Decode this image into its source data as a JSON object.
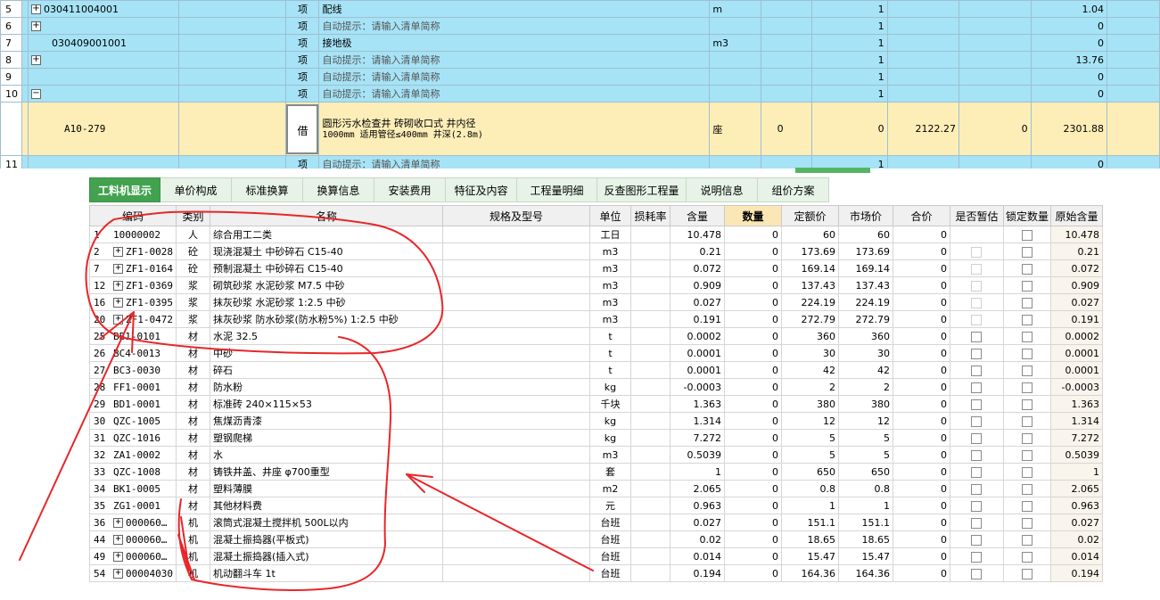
{
  "top_rows": [
    {
      "row": "5",
      "expand": "+",
      "code": "030411004001",
      "type": "项",
      "name": "配线",
      "hint": false,
      "unit": "m",
      "qty": "",
      "formula": "1",
      "price": "",
      "hj": "",
      "total": "1.04"
    },
    {
      "row": "6",
      "expand": "+",
      "code": "",
      "type": "项",
      "name": "自动提示：请输入清单简称",
      "hint": true,
      "unit": "",
      "qty": "",
      "formula": "1",
      "price": "",
      "hj": "",
      "total": "0"
    },
    {
      "row": "7",
      "expand": "",
      "code": "030409001001",
      "type": "项",
      "name": "接地极",
      "hint": false,
      "unit": "m3",
      "qty": "",
      "formula": "1",
      "price": "",
      "hj": "",
      "total": "0"
    },
    {
      "row": "8",
      "expand": "+",
      "code": "",
      "type": "项",
      "name": "自动提示：请输入清单简称",
      "hint": true,
      "unit": "",
      "qty": "",
      "formula": "1",
      "price": "",
      "hj": "",
      "total": "13.76"
    },
    {
      "row": "9",
      "expand": "",
      "code": "",
      "type": "项",
      "name": "自动提示：请输入清单简称",
      "hint": true,
      "unit": "",
      "qty": "",
      "formula": "1",
      "price": "",
      "hj": "",
      "total": "0"
    },
    {
      "row": "10",
      "expand": "−",
      "code": "",
      "type": "项",
      "name": "自动提示：请输入清单简称",
      "hint": true,
      "unit": "",
      "qty": "",
      "formula": "1",
      "price": "",
      "hj": "",
      "total": "0"
    }
  ],
  "selected_row": {
    "code": "A10-279",
    "type": "借",
    "name_line1": "圆形污水检查井 砖砌收口式 井内径",
    "name_line2": "1000mm 适用管径≤400mm 井深(2.8m)",
    "unit": "座",
    "qty": "0",
    "formula": "0",
    "price": "2122.27",
    "hj": "0",
    "total": "2301.88"
  },
  "partial_row": {
    "row": "11",
    "type": "项",
    "name": "自动提示：请输入清单简称",
    "formula": "1",
    "total": "0"
  },
  "tabs": [
    "工料机显示",
    "单价构成",
    "标准换算",
    "换算信息",
    "安装费用",
    "特征及内容",
    "工程量明细",
    "反查图形工程量",
    "说明信息",
    "组价方案"
  ],
  "columns": [
    "编码",
    "类别",
    "名称",
    "规格及型号",
    "单位",
    "损耗率",
    "含量",
    "数量",
    "定额价",
    "市场价",
    "合价",
    "是否暂估",
    "锁定数量",
    "原始含量"
  ],
  "rows": [
    {
      "n": "1",
      "exp": false,
      "code": "10000002",
      "cat": "人",
      "name": "综合用工二类",
      "spec": "",
      "unit": "工日",
      "content": "10.478",
      "qty": "0",
      "quota": "60",
      "market": "60",
      "sum": "0",
      "est": false,
      "orig": "10.478"
    },
    {
      "n": "2",
      "exp": true,
      "code": "ZF1-0028",
      "cat": "砼",
      "name": "现浇混凝土 中砂碎石 C15-40",
      "spec": "",
      "unit": "m3",
      "content": "0.21",
      "qty": "0",
      "quota": "173.69",
      "market": "173.69",
      "sum": "0",
      "est": true,
      "orig": "0.21"
    },
    {
      "n": "7",
      "exp": true,
      "code": "ZF1-0164",
      "cat": "砼",
      "name": "预制混凝土 中砂碎石 C15-40",
      "spec": "",
      "unit": "m3",
      "content": "0.072",
      "qty": "0",
      "quota": "169.14",
      "market": "169.14",
      "sum": "0",
      "est": true,
      "orig": "0.072"
    },
    {
      "n": "12",
      "exp": true,
      "code": "ZF1-0369",
      "cat": "浆",
      "name": "砌筑砂浆 水泥砂浆 M7.5 中砂",
      "spec": "",
      "unit": "m3",
      "content": "0.909",
      "qty": "0",
      "quota": "137.43",
      "market": "137.43",
      "sum": "0",
      "est": true,
      "orig": "0.909"
    },
    {
      "n": "16",
      "exp": true,
      "code": "ZF1-0395",
      "cat": "浆",
      "name": "抹灰砂浆 水泥砂浆 1:2.5 中砂",
      "spec": "",
      "unit": "m3",
      "content": "0.027",
      "qty": "0",
      "quota": "224.19",
      "market": "224.19",
      "sum": "0",
      "est": true,
      "orig": "0.027"
    },
    {
      "n": "20",
      "exp": true,
      "code": "ZF1-0472",
      "cat": "浆",
      "name": "抹灰砂浆 防水砂浆(防水粉5%) 1:2.5 中砂",
      "spec": "",
      "unit": "m3",
      "content": "0.191",
      "qty": "0",
      "quota": "272.79",
      "market": "272.79",
      "sum": "0",
      "est": true,
      "orig": "0.191"
    },
    {
      "n": "25",
      "exp": false,
      "code": "BB1-0101",
      "cat": "材",
      "name": "水泥 32.5",
      "spec": "",
      "unit": "t",
      "content": "0.0002",
      "qty": "0",
      "quota": "360",
      "market": "360",
      "sum": "0",
      "est": false,
      "orig": "0.0002"
    },
    {
      "n": "26",
      "exp": false,
      "code": "BC4-0013",
      "cat": "材",
      "name": "中砂",
      "spec": "",
      "unit": "t",
      "content": "0.0001",
      "qty": "0",
      "quota": "30",
      "market": "30",
      "sum": "0",
      "est": false,
      "orig": "0.0001"
    },
    {
      "n": "27",
      "exp": false,
      "code": "BC3-0030",
      "cat": "材",
      "name": "碎石",
      "spec": "",
      "unit": "t",
      "content": "0.0001",
      "qty": "0",
      "quota": "42",
      "market": "42",
      "sum": "0",
      "est": false,
      "orig": "0.0001"
    },
    {
      "n": "28",
      "exp": false,
      "code": "FF1-0001",
      "cat": "材",
      "name": "防水粉",
      "spec": "",
      "unit": "kg",
      "content": "-0.0003",
      "qty": "0",
      "quota": "2",
      "market": "2",
      "sum": "0",
      "est": false,
      "orig": "-0.0003"
    },
    {
      "n": "29",
      "exp": false,
      "code": "BD1-0001",
      "cat": "材",
      "name": "标准砖 240×115×53",
      "spec": "",
      "unit": "千块",
      "content": "1.363",
      "qty": "0",
      "quota": "380",
      "market": "380",
      "sum": "0",
      "est": false,
      "orig": "1.363"
    },
    {
      "n": "30",
      "exp": false,
      "code": "QZC-1005",
      "cat": "材",
      "name": "焦煤沥青漆",
      "spec": "",
      "unit": "kg",
      "content": "1.314",
      "qty": "0",
      "quota": "12",
      "market": "12",
      "sum": "0",
      "est": false,
      "orig": "1.314"
    },
    {
      "n": "31",
      "exp": false,
      "code": "QZC-1016",
      "cat": "材",
      "name": "塑钢爬梯",
      "spec": "",
      "unit": "kg",
      "content": "7.272",
      "qty": "0",
      "quota": "5",
      "market": "5",
      "sum": "0",
      "est": false,
      "orig": "7.272"
    },
    {
      "n": "32",
      "exp": false,
      "code": "ZA1-0002",
      "cat": "材",
      "name": "水",
      "spec": "",
      "unit": "m3",
      "content": "0.5039",
      "qty": "0",
      "quota": "5",
      "market": "5",
      "sum": "0",
      "est": false,
      "orig": "0.5039"
    },
    {
      "n": "33",
      "exp": false,
      "code": "QZC-1008",
      "cat": "材",
      "name": "铸铁井盖、井座 φ700重型",
      "spec": "",
      "unit": "套",
      "content": "1",
      "qty": "0",
      "quota": "650",
      "market": "650",
      "sum": "0",
      "est": false,
      "orig": "1"
    },
    {
      "n": "34",
      "exp": false,
      "code": "BK1-0005",
      "cat": "材",
      "name": "塑料薄膜",
      "spec": "",
      "unit": "m2",
      "content": "2.065",
      "qty": "0",
      "quota": "0.8",
      "market": "0.8",
      "sum": "0",
      "est": false,
      "orig": "2.065"
    },
    {
      "n": "35",
      "exp": false,
      "code": "ZG1-0001",
      "cat": "材",
      "name": "其他材料费",
      "spec": "",
      "unit": "元",
      "content": "0.963",
      "qty": "0",
      "quota": "1",
      "market": "1",
      "sum": "0",
      "est": false,
      "orig": "0.963"
    },
    {
      "n": "36",
      "exp": true,
      "code": "000060…",
      "cat": "机",
      "name": "滚筒式混凝土搅拌机 500L以内",
      "spec": "",
      "unit": "台班",
      "content": "0.027",
      "qty": "0",
      "quota": "151.1",
      "market": "151.1",
      "sum": "0",
      "est": false,
      "orig": "0.027"
    },
    {
      "n": "44",
      "exp": true,
      "code": "000060…",
      "cat": "机",
      "name": "混凝土振捣器(平板式)",
      "spec": "",
      "unit": "台班",
      "content": "0.02",
      "qty": "0",
      "quota": "18.65",
      "market": "18.65",
      "sum": "0",
      "est": false,
      "orig": "0.02"
    },
    {
      "n": "49",
      "exp": true,
      "code": "000060…",
      "cat": "机",
      "name": "混凝土振捣器(插入式)",
      "spec": "",
      "unit": "台班",
      "content": "0.014",
      "qty": "0",
      "quota": "15.47",
      "market": "15.47",
      "sum": "0",
      "est": false,
      "orig": "0.014"
    },
    {
      "n": "54",
      "exp": true,
      "code": "00004030",
      "cat": "机",
      "name": "机动翻斗车 1t",
      "spec": "",
      "unit": "台班",
      "content": "0.194",
      "qty": "0",
      "quota": "164.36",
      "market": "164.36",
      "sum": "0",
      "est": false,
      "orig": "0.194"
    }
  ],
  "colors": {
    "top_row_bg": "#a6e3f6",
    "selected_bg": "#fdeeb8",
    "active_tab": "#42a24f",
    "tab_bg": "#e7f3e7",
    "annotation": "#e8262a"
  }
}
